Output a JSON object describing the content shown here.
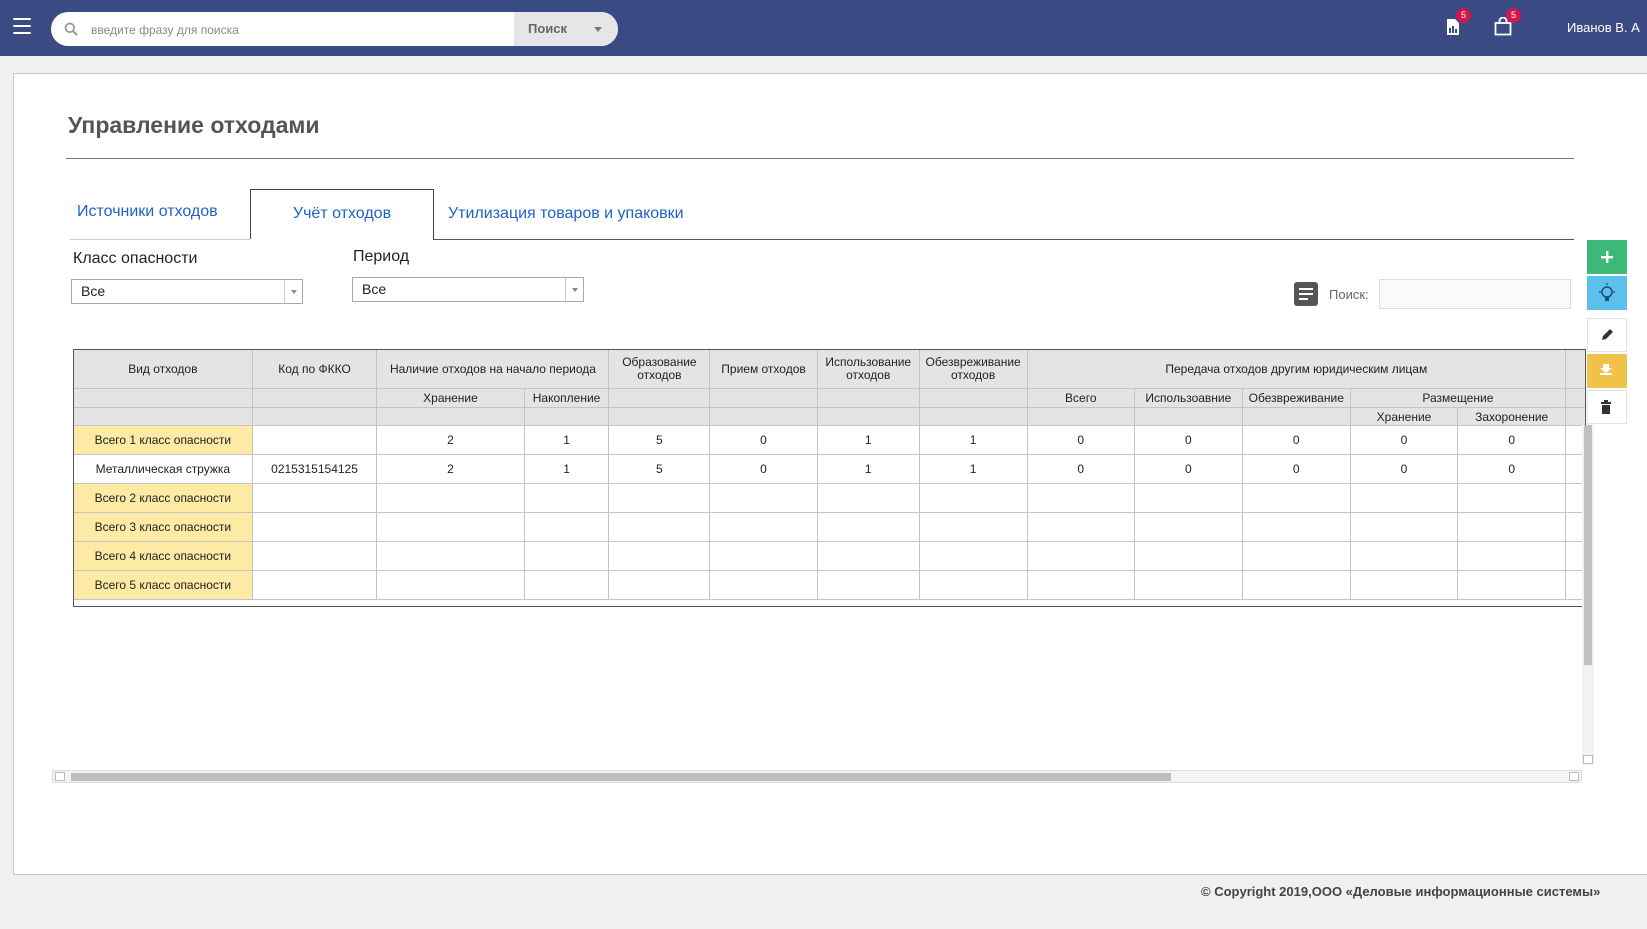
{
  "header": {
    "search_placeholder": "введите фразу для поиска",
    "search_button": "Поиск",
    "notifications": [
      {
        "icon": "report-icon",
        "count": "5"
      },
      {
        "icon": "shopping-bag-icon",
        "count": "5"
      }
    ],
    "user_name": "Иванов В. А"
  },
  "page": {
    "title": "Управление отходами"
  },
  "tabs": [
    {
      "label": "Источники отходов",
      "active": false
    },
    {
      "label": "Учёт отходов",
      "active": true
    },
    {
      "label": "Утилизация товаров и упаковки",
      "active": false
    }
  ],
  "filters": {
    "hazard_class_label": "Класс опасности",
    "hazard_class_value": "Все",
    "period_label": "Период",
    "period_value": "Все",
    "search_label": "Поиск:",
    "search_value": ""
  },
  "actions": [
    {
      "name": "add-button",
      "icon": "plus-icon",
      "color": "#3cb878"
    },
    {
      "name": "hint-button",
      "icon": "lightbulb-icon",
      "color": "#5bc0eb"
    },
    {
      "name": "edit-button",
      "icon": "pencil-icon",
      "color": "#ffffff"
    },
    {
      "name": "export-button",
      "icon": "download-icon",
      "color": "#f0c24a"
    },
    {
      "name": "delete-button",
      "icon": "trash-icon",
      "color": "#ffffff"
    }
  ],
  "table": {
    "headers": {
      "waste_type": "Вид отходов",
      "fkko_code": "Код по ФККО",
      "start_balance": "Наличие отходов на начало периода",
      "storage": "Хранение",
      "accumulation": "Накопление",
      "formation": "Образование отходов",
      "reception": "Прием отходов",
      "usage": "Использование отходов",
      "neutralization": "Обезвреживание отходов",
      "transfer": "Передача отходов другим юридическим лицам",
      "transfer_total": "Всего",
      "transfer_usage": "Использоавние",
      "transfer_neutralization": "Обезвреживание",
      "placement": "Размещение",
      "placement_storage": "Хранение",
      "placement_burial": "Захоронение"
    },
    "rows": [
      {
        "name": "Всего 1 класс опасности",
        "total": true,
        "code": "",
        "values": [
          "2",
          "1",
          "5",
          "0",
          "1",
          "1",
          "0",
          "0",
          "0",
          "0",
          "0"
        ]
      },
      {
        "name": "Металлическая стружка",
        "total": false,
        "code": "0215315154125",
        "values": [
          "2",
          "1",
          "5",
          "0",
          "1",
          "1",
          "0",
          "0",
          "0",
          "0",
          "0"
        ]
      },
      {
        "name": "Всего 2 класс опасности",
        "total": true,
        "code": "",
        "values": [
          "",
          "",
          "",
          "",
          "",
          "",
          "",
          "",
          "",
          "",
          ""
        ]
      },
      {
        "name": "Всего 3 класс опасности",
        "total": true,
        "code": "",
        "values": [
          "",
          "",
          "",
          "",
          "",
          "",
          "",
          "",
          "",
          "",
          ""
        ]
      },
      {
        "name": "Всего 4 класс опасности",
        "total": true,
        "code": "",
        "values": [
          "",
          "",
          "",
          "",
          "",
          "",
          "",
          "",
          "",
          "",
          ""
        ]
      },
      {
        "name": "Всего 5 класс опасности",
        "total": true,
        "code": "",
        "values": [
          "",
          "",
          "",
          "",
          "",
          "",
          "",
          "",
          "",
          "",
          ""
        ]
      }
    ]
  },
  "footer": {
    "copyright": "© Copyright 2019,ООО «Деловые информационные системы»"
  }
}
